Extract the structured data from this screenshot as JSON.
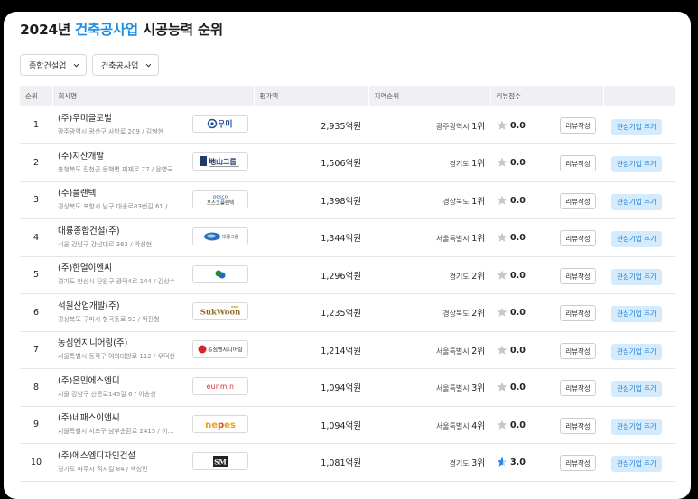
{
  "title": {
    "year": "2024년",
    "business": "건축공사업",
    "suffix": "시공능력 순위"
  },
  "filters": [
    {
      "label": "종합건설업",
      "icon": "chevron-down-icon"
    },
    {
      "label": "건축공사업",
      "icon": "chevron-down-icon"
    }
  ],
  "columns": {
    "rank": "순위",
    "company": "회사명",
    "amount": "평가액",
    "region": "지역순위",
    "review": "리뷰점수"
  },
  "buttons": {
    "review": "리뷰작성",
    "favorite": "관심기업 추가"
  },
  "colors": {
    "accent": "#1d8ee0",
    "fav_bg": "#d3ebfd",
    "fav_text": "#1d7fd4",
    "star_gray": "#c4c8ce",
    "star_blue": "#2d8ae6"
  },
  "rows": [
    {
      "rank": "1",
      "name": "(주)우미글로벌",
      "address": "광주광역시 광산구 사암로 209 / 김형현",
      "amount": "2,935억원",
      "region": "광주광역시",
      "region_rank": "1위",
      "score": "0.0",
      "star": "gray",
      "logo": "우미"
    },
    {
      "rank": "2",
      "name": "(주)지산개발",
      "address": "충청북도 진천군 문백면 피재로 77 / 윤영국",
      "amount": "1,506억원",
      "region": "경기도",
      "region_rank": "1위",
      "score": "0.0",
      "star": "gray",
      "logo": "地山그룹"
    },
    {
      "rank": "3",
      "name": "(주)플랜텍",
      "address": "경상북도 포항시 남구 대송로83번길 61 / …",
      "amount": "1,398억원",
      "region": "경상북도",
      "region_rank": "1위",
      "score": "0.0",
      "star": "gray",
      "logo": "posco 포스코플랜텍"
    },
    {
      "rank": "4",
      "name": "대륭종합건설(주)",
      "address": "서울 강남구 강남대로 362 / 박성현",
      "amount": "1,344억원",
      "region": "서울특별시",
      "region_rank": "1위",
      "score": "0.0",
      "star": "gray",
      "logo": "대륭그룹"
    },
    {
      "rank": "5",
      "name": "(주)한얼이엔씨",
      "address": "경기도 안산시 단원구 광덕4로 144 / 김상수",
      "amount": "1,296억원",
      "region": "경기도",
      "region_rank": "2위",
      "score": "0.0",
      "star": "gray",
      "logo": ""
    },
    {
      "rank": "6",
      "name": "석원산업개발(주)",
      "address": "경상북도 구미시 형곡동로 93 / 박진형",
      "amount": "1,235억원",
      "region": "경상북도",
      "region_rank": "2위",
      "score": "0.0",
      "star": "gray",
      "logo": "SukWoon"
    },
    {
      "rank": "7",
      "name": "농심엔지니어링(주)",
      "address": "서울특별시 동작구 여의대방로 112 / 우덕현",
      "amount": "1,214억원",
      "region": "서울특별시",
      "region_rank": "2위",
      "score": "0.0",
      "star": "gray",
      "logo": "농심엔지니어링"
    },
    {
      "rank": "8",
      "name": "(주)은민에스엔디",
      "address": "서울 강남구 선릉로145길 6 / 이승성",
      "amount": "1,094억원",
      "region": "서울특별시",
      "region_rank": "3위",
      "score": "0.0",
      "star": "gray",
      "logo": "eunmin"
    },
    {
      "rank": "9",
      "name": "(주)네패스이앤씨",
      "address": "서울특별시 서초구 남부순환로 2415 / 이…",
      "amount": "1,094억원",
      "region": "서울특별시",
      "region_rank": "4위",
      "score": "0.0",
      "star": "gray",
      "logo": "nepes"
    },
    {
      "rank": "10",
      "name": "(주)에스엠디자인건설",
      "address": "경기도 파주시 직지길 84 / 백성민",
      "amount": "1,081억원",
      "region": "경기도",
      "region_rank": "3위",
      "score": "3.0",
      "star": "half-blue",
      "logo": "SM"
    }
  ]
}
